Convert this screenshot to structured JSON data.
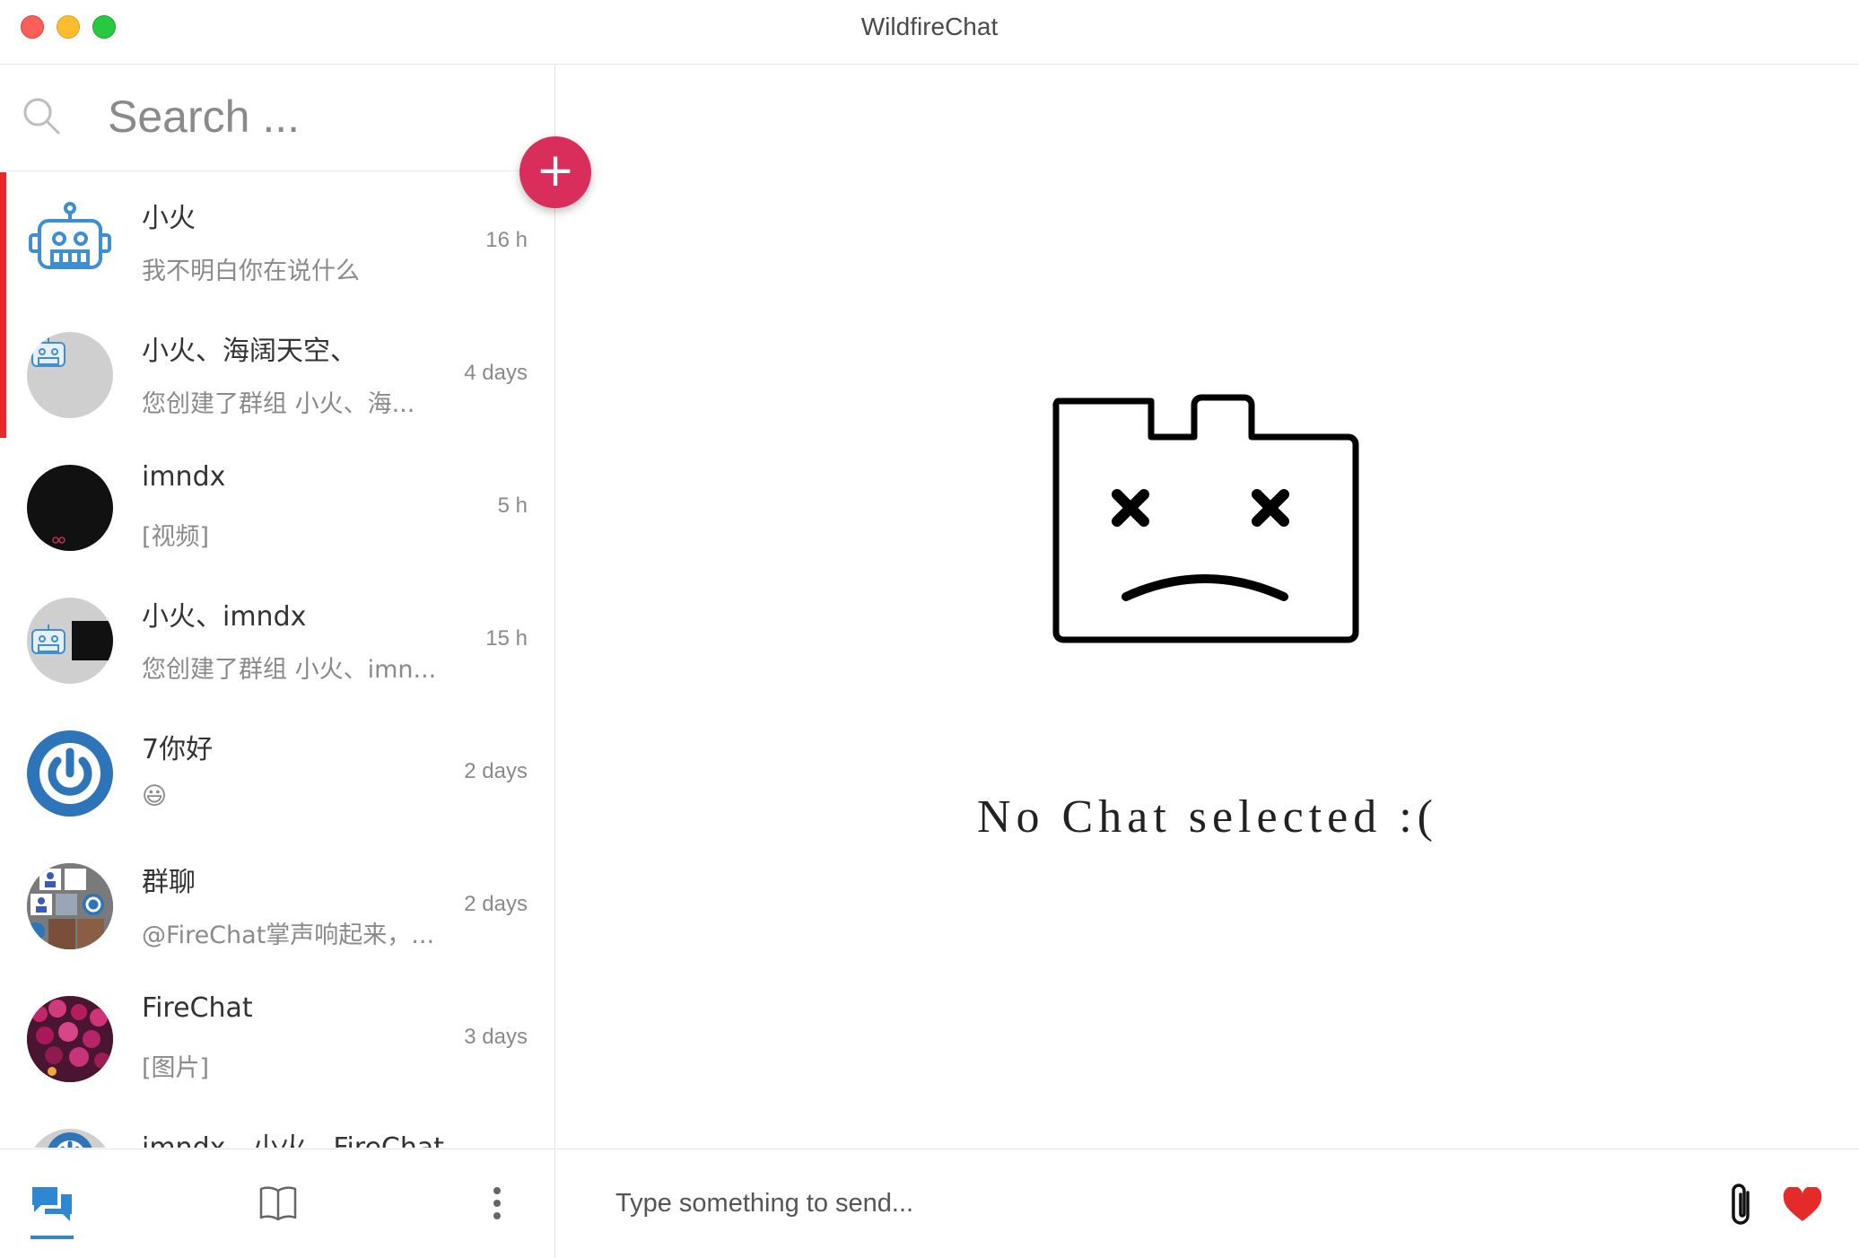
{
  "window": {
    "title": "WildfireChat"
  },
  "search": {
    "placeholder": "Search ..."
  },
  "add_button": {
    "label": "+"
  },
  "conversations": [
    {
      "name": "小火",
      "last_message": "我不明白你在说什么",
      "time": "16 h",
      "avatar_icon": "robot-icon"
    },
    {
      "name": "小火、海阔天空、",
      "last_message": "您创建了群组 小火、海...",
      "time": "4 days",
      "avatar_icon": "group-robot-icon"
    },
    {
      "name": "imndx",
      "last_message": "[视频]",
      "time": "5 h",
      "avatar_icon": "dark-avatar"
    },
    {
      "name": "小火、imndx",
      "last_message": "您创建了群组 小火、imn...",
      "time": "15 h",
      "avatar_icon": "group-robot-dark-icon"
    },
    {
      "name": "7你好",
      "last_message": "😃",
      "time": "2 days",
      "avatar_icon": "power-icon"
    },
    {
      "name": "群聊",
      "last_message": "@FireChat掌声响起来，...",
      "time": "2 days",
      "avatar_icon": "group-mosaic-icon"
    },
    {
      "name": "FireChat",
      "last_message": "[图片]",
      "time": "3 days",
      "avatar_icon": "flowers-photo"
    },
    {
      "name": "imndx、小火、FireChat",
      "last_message": "",
      "time": "",
      "avatar_icon": "power-icon"
    }
  ],
  "empty_state": {
    "text": "No Chat selected :("
  },
  "composer": {
    "placeholder": "Type something to send..."
  },
  "colors": {
    "accent": "#d92d5c",
    "unread_bar": "#e52a2a",
    "tab_active": "#2f86d2",
    "heart": "#e52a2a"
  }
}
